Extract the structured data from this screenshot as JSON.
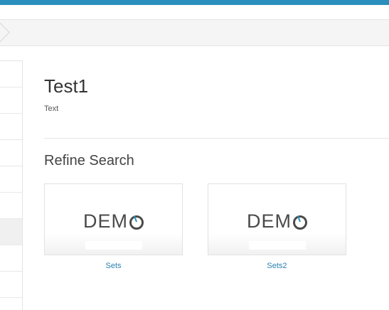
{
  "content": {
    "title": "Test1",
    "description": "Text"
  },
  "refine": {
    "heading": "Refine Search",
    "cards": [
      {
        "logo": "DEM",
        "label": "Sets"
      },
      {
        "logo": "DEM",
        "label": "Sets2"
      }
    ]
  },
  "colors": {
    "accent": "#2a8fbd",
    "link": "#2a7fb0"
  },
  "icons": {
    "logo_mark": "demo-logo-icon"
  }
}
